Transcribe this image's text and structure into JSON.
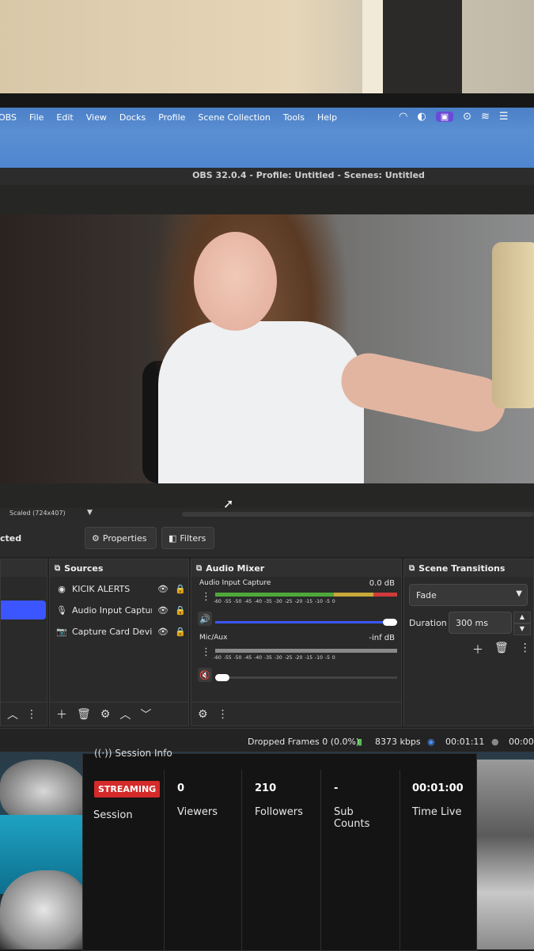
{
  "menubar": {
    "app_fragment": "OBS",
    "items": [
      "File",
      "Edit",
      "View",
      "Docks",
      "Profile",
      "Scene Collection",
      "Tools",
      "Help"
    ]
  },
  "window": {
    "title": "OBS 32.0.4 - Profile: Untitled - Scenes: Untitled"
  },
  "preview": {
    "scale_label": "Scaled (724x407)"
  },
  "context_bar": {
    "selection_label": "cted",
    "properties_label": "Properties",
    "filters_label": "Filters"
  },
  "sources": {
    "title": "Sources",
    "items": [
      {
        "name": "KICIK ALERTS",
        "icon": "browser-icon"
      },
      {
        "name": "Audio Input Captur",
        "icon": "microphone-icon"
      },
      {
        "name": "Capture Card Devic",
        "icon": "camera-icon"
      }
    ]
  },
  "audio_mixer": {
    "title": "Audio Mixer",
    "scale": [
      "-60",
      "-55",
      "-50",
      "-45",
      "-40",
      "-35",
      "-30",
      "-25",
      "-20",
      "-15",
      "-10",
      "-5",
      "0"
    ],
    "channels": [
      {
        "name": "Audio Input Capture",
        "db": "0.0 dB",
        "muted": false,
        "level": 1.0
      },
      {
        "name": "Mic/Aux",
        "db": "-inf dB",
        "muted": true,
        "level": 0.0
      }
    ]
  },
  "scene_transitions": {
    "title": "Scene Transitions",
    "transition": "Fade",
    "duration_label": "Duration",
    "duration_value": "300 ms"
  },
  "status_bar": {
    "dropped_frames": "Dropped Frames 0 (0.0%)",
    "bitrate": "8373 kbps",
    "stream_time": "00:01:11",
    "record_time": "00:00:"
  },
  "session_info": {
    "title": "Session Info",
    "badge": "STREAMING",
    "session_label": "Session",
    "stats": [
      {
        "value": "0",
        "label": "Viewers"
      },
      {
        "value": "210",
        "label": "Followers"
      },
      {
        "value": "-",
        "label": "Sub Counts"
      },
      {
        "value": "00:01:00",
        "label": "Time Live"
      }
    ]
  },
  "colors": {
    "menubar": "#4f86cf",
    "selection": "#3b56ff",
    "streaming_badge": "#d42a2a"
  }
}
